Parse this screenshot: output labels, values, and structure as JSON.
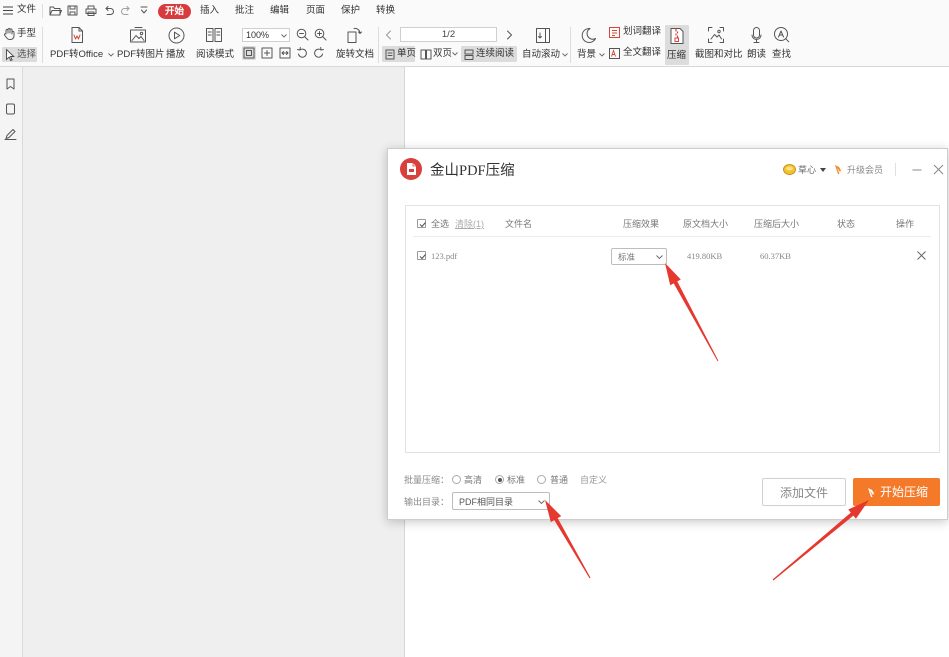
{
  "menubar": {
    "file_label": "文件",
    "tabs": [
      {
        "label": "开始",
        "active": true
      },
      {
        "label": "插入"
      },
      {
        "label": "批注"
      },
      {
        "label": "编辑"
      },
      {
        "label": "页面"
      },
      {
        "label": "保护"
      },
      {
        "label": "转换"
      }
    ]
  },
  "toolbar": {
    "hand": "手型",
    "select": "选择",
    "pdf_to_office": "PDF转Office",
    "pdf_to_image": "PDF转图片",
    "play": "播放",
    "read_mode": "阅读模式",
    "zoom": "100%",
    "rotate": "旋转文档",
    "page_indicator": "1/2",
    "single_page": "单页",
    "double_page": "双页",
    "continuous": "连续阅读",
    "auto_scroll": "自动滚动",
    "background": "背景",
    "word_translate": "划词翻译",
    "full_translate": "全文翻译",
    "compress": "压缩",
    "screenshot_compare": "截图和对比",
    "read_aloud": "朗读",
    "find": "查找",
    "active": {
      "select_tool": true,
      "actual_size": true,
      "single_page": true,
      "continuous": true,
      "compress": true
    }
  },
  "dialog": {
    "title": "金山PDF压缩",
    "username": "草心",
    "upgrade": "升级会员",
    "table": {
      "select_all_checked": true,
      "select_all": "全选",
      "clear": "清除(1)",
      "columns": {
        "filename": "文件名",
        "effect": "压缩效果",
        "original_size": "原文档大小",
        "compressed_size": "压缩后大小",
        "status": "状态",
        "action": "操作"
      },
      "rows": [
        {
          "checked": true,
          "name": "123.pdf",
          "effect": "标准",
          "original_size": "419.80KB",
          "compressed_size": "60.37KB"
        }
      ]
    },
    "batch": {
      "label": "批量压缩：",
      "options": [
        {
          "label": "高清"
        },
        {
          "label": "标准",
          "selected": true
        },
        {
          "label": "普通"
        }
      ],
      "custom": "自定义"
    },
    "output": {
      "label": "输出目录：",
      "value": "PDF相同目录"
    },
    "buttons": {
      "add": "添加文件",
      "start": "开始压缩"
    }
  },
  "colors": {
    "accent_red": "#d83b3e",
    "start_button": "#f47a2a",
    "annotation_arrow": "#e5382f"
  }
}
